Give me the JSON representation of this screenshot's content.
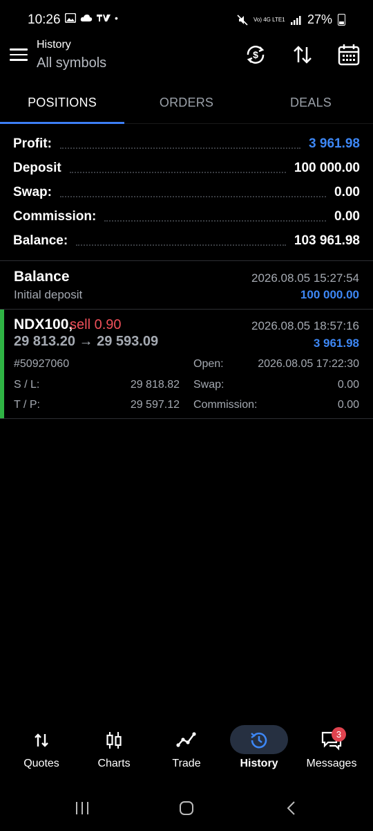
{
  "status_bar": {
    "time": "10:26",
    "signal": "Vo) 4G LTE1",
    "battery": "27%"
  },
  "header": {
    "title": "History",
    "subtitle": "All symbols"
  },
  "tabs": [
    {
      "label": "POSITIONS",
      "active": true
    },
    {
      "label": "ORDERS",
      "active": false
    },
    {
      "label": "DEALS",
      "active": false
    }
  ],
  "summary": {
    "profit_label": "Profit:",
    "profit_value": "3 961.98",
    "deposit_label": "Deposit",
    "deposit_value": "100 000.00",
    "swap_label": "Swap:",
    "swap_value": "0.00",
    "commission_label": "Commission:",
    "commission_value": "0.00",
    "balance_label": "Balance:",
    "balance_value": "103 961.98"
  },
  "balance_entry": {
    "title": "Balance",
    "subtitle": "Initial deposit",
    "datetime": "2026.08.05 15:27:54",
    "amount": "100 000.00"
  },
  "position": {
    "symbol": "NDX100,",
    "side": "sell 0.90",
    "prices": "29 813.20 → 29 593.09",
    "close_time": "2026.08.05 18:57:16",
    "profit": "3 961.98",
    "ticket": "#50927060",
    "open_label": "Open:",
    "open_time": "2026.08.05 17:22:30",
    "sl_label": "S / L:",
    "sl_value": "29 818.82",
    "swap_label": "Swap:",
    "swap_value": "0.00",
    "tp_label": "T / P:",
    "tp_value": "29 597.12",
    "commission_label": "Commission:",
    "commission_value": "0.00"
  },
  "bottom_nav": [
    {
      "label": "Quotes",
      "icon": "quotes-icon"
    },
    {
      "label": "Charts",
      "icon": "charts-icon"
    },
    {
      "label": "Trade",
      "icon": "trade-icon"
    },
    {
      "label": "History",
      "icon": "history-icon",
      "active": true
    },
    {
      "label": "Messages",
      "icon": "messages-icon",
      "badge": "3"
    }
  ],
  "colors": {
    "accent": "#3d87f5",
    "sell": "#f0505a",
    "buy_bar": "#2fb344"
  }
}
